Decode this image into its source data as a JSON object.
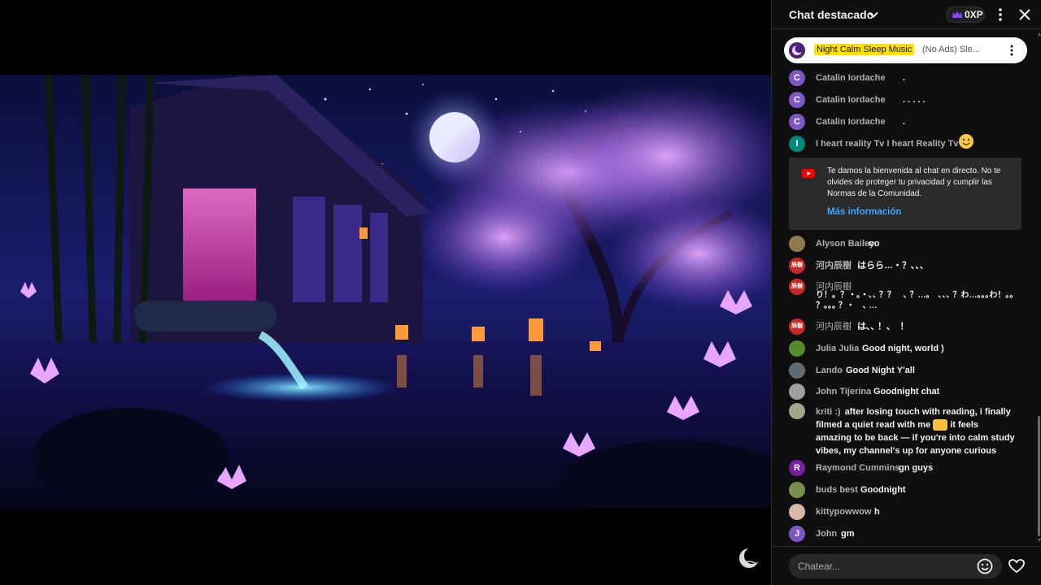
{
  "chat": {
    "title": "Chat destacado",
    "points": "0XP",
    "pinned": {
      "author": "Night Calm Sleep Music",
      "text": "(No Ads) Sle..."
    },
    "messages": [
      {
        "author": "Catalin Iordache",
        "text": ".",
        "avatar_letter": "C",
        "avatar_color": "#7e57c2"
      },
      {
        "author": "Catalin Iordache",
        "text": ". . . . .",
        "avatar_letter": "C",
        "avatar_color": "#7e57c2"
      },
      {
        "author": "Catalin Iordache",
        "text": ".",
        "avatar_letter": "C",
        "avatar_color": "#7e57c2"
      },
      {
        "author": "I heart reality Tv I heart Reality Tv",
        "text": "",
        "avatar_letter": "I",
        "avatar_color": "#00897b",
        "emoji": "smile"
      },
      {
        "author": "Alyson Bailey",
        "text": "oo",
        "avatar_letter": "",
        "avatar_color": "#8d7a52"
      },
      {
        "author": "河内辰樹",
        "text": "はらら…・？､､､",
        "avatar_letter": "辰樹",
        "avatar_color": "#c62828"
      },
      {
        "author": "河内辰樹",
        "text": "り！。？・。・､､ ？？　､ ？…｡　､､､ ？わ…｡｡｡わ！｡｡ ？｡｡｡ ？・　､ …",
        "avatar_letter": "辰樹",
        "avatar_color": "#c62828"
      },
      {
        "author": "河内辰樹",
        "text": "は､､ ！､　！",
        "avatar_letter": "辰樹",
        "avatar_color": "#c62828"
      },
      {
        "author": "Julia Julia",
        "text": "Good night, world )",
        "avatar_letter": "",
        "avatar_color": "#558b2f"
      },
      {
        "author": "Lando",
        "text": "Good Night Y'all",
        "avatar_letter": "",
        "avatar_color": "#5f6b73"
      },
      {
        "author": "John Tijerina",
        "text": "Goodnight chat",
        "avatar_letter": "",
        "avatar_color": "#9e9e9e"
      },
      {
        "author": "kriti :)",
        "text_before": "after losing touch with reading, i finally filmed a quiet read with me",
        "text_after": "it feels amazing to be back — if you're into calm study vibes, my channel's up for anyone curious",
        "avatar_letter": "",
        "avatar_color": "#a5a58d",
        "emoji": "hug"
      },
      {
        "author": "Raymond Cummins",
        "text": "gn guys",
        "avatar_letter": "R",
        "avatar_color": "#7b1fa2"
      },
      {
        "author": "buds best",
        "text": "Goodnight",
        "avatar_letter": "",
        "avatar_color": "#7a8f4c"
      },
      {
        "author": "kittypowwow",
        "text": "h",
        "avatar_letter": "",
        "avatar_color": "#d7b8a8"
      },
      {
        "author": "John",
        "text": "gm",
        "avatar_letter": "J",
        "avatar_color": "#7e57c2"
      }
    ],
    "welcome": {
      "text": "Te damos la bienvenida al chat en directo. No te olvides de proteger tu privacidad y cumplir las Normas de la Comunidad.",
      "link": "Más información"
    },
    "input_placeholder": "Chatear..."
  },
  "colors": {
    "panel_bg": "#0f0f0f",
    "pinned_highlight": "#ffe100",
    "link_blue": "#3ea6ff",
    "youtube_red": "#ff0000"
  },
  "icons": [
    "chevron-down-icon",
    "crown-icon",
    "more-vert-icon",
    "close-icon",
    "youtube-icon",
    "emoji-icon",
    "heart-icon",
    "moon-logo-icon"
  ]
}
